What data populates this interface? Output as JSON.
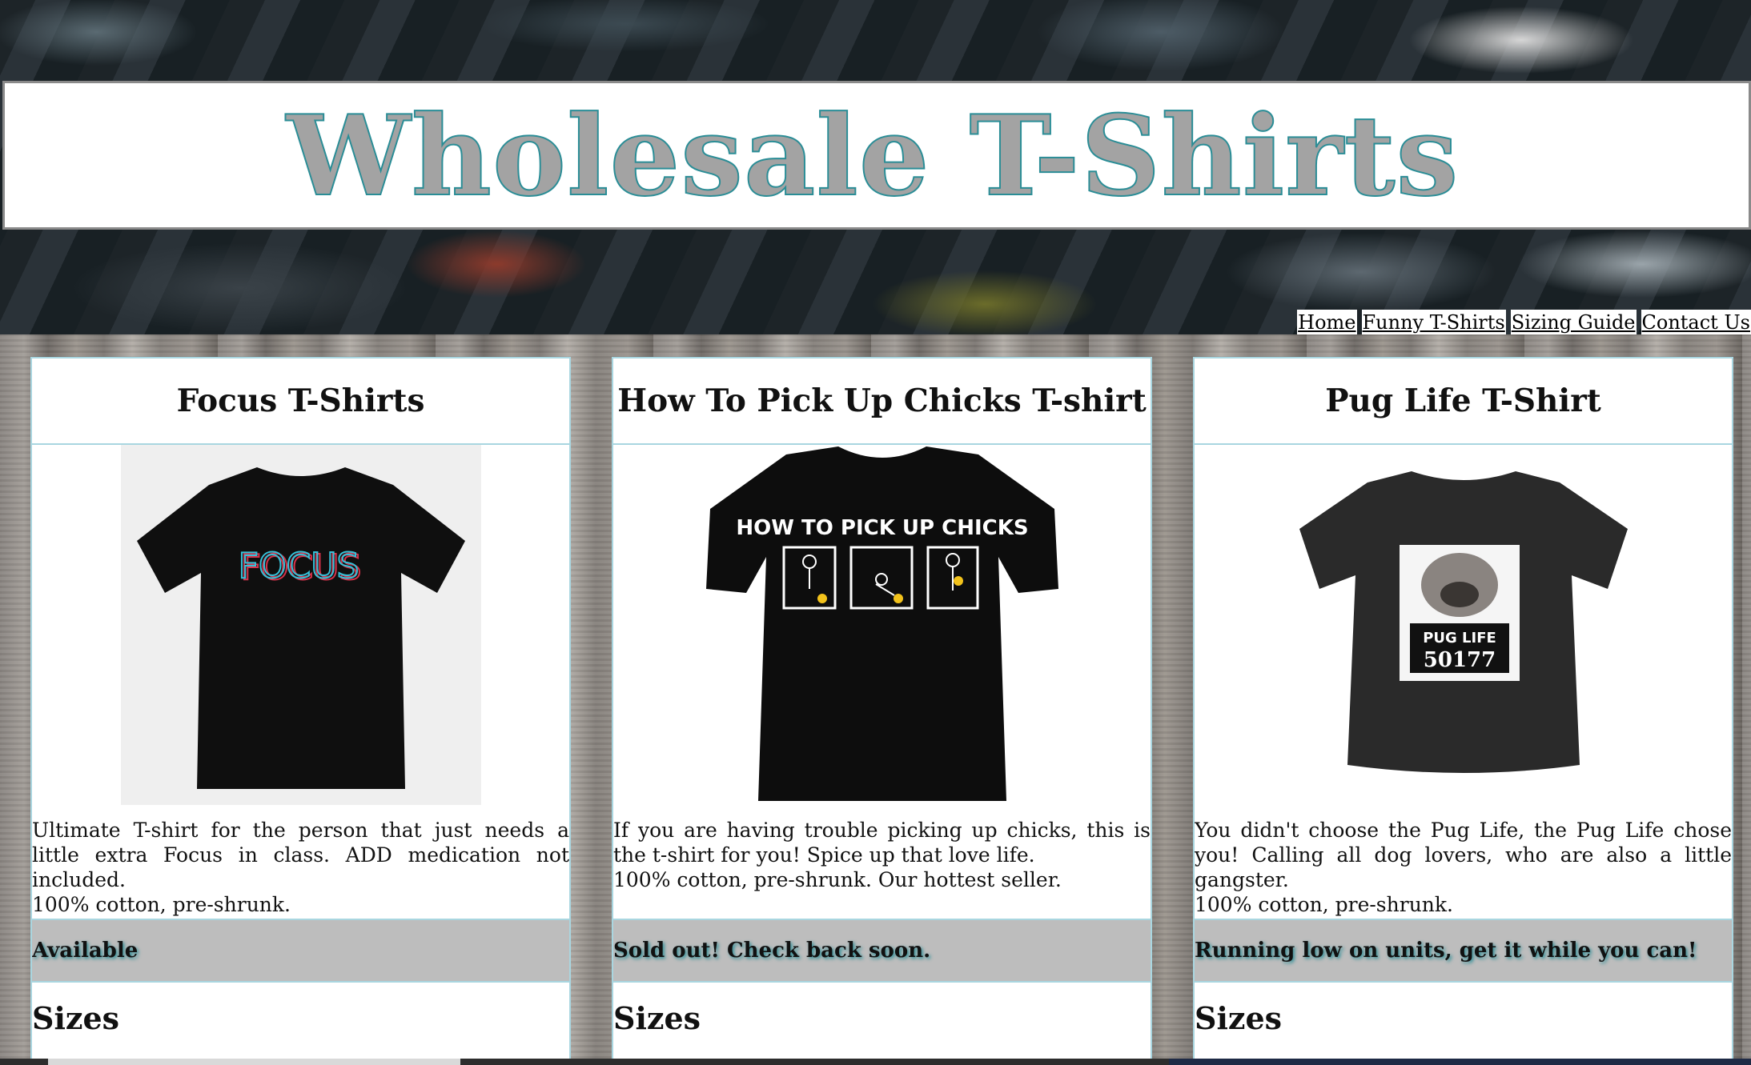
{
  "header": {
    "site_title": "Wholesale T-Shirts",
    "nav": [
      {
        "label": "Home"
      },
      {
        "label": "Funny T-Shirts"
      },
      {
        "label": "Sizing Guide"
      },
      {
        "label": "Contact Us"
      }
    ]
  },
  "products": [
    {
      "title": "Focus T-Shirts",
      "shirt_print": "FOCUS",
      "description": "Ultimate T-shirt for the person that just needs a little extra Focus in class. ADD medication not included.",
      "material": "100% cotton, pre-shrunk.",
      "status": "Available",
      "sizes_label": "Sizes"
    },
    {
      "title": "How To Pick Up Chicks T-shirt",
      "shirt_print": "HOW TO PICK UP CHICKS",
      "description": "If you are having trouble picking up chicks, this is the t-shirt for you! Spice up that love life.",
      "material": "100% cotton, pre-shrunk. Our hottest seller.",
      "status": "Sold out! Check back soon.",
      "sizes_label": "Sizes"
    },
    {
      "title": "Pug Life T-Shirt",
      "shirt_print": "PUG LIFE",
      "shirt_number": "50177",
      "description": "You didn't choose the Pug Life, the Pug Life chose you! Calling all dog lovers, who are also a little gangster.",
      "material": "100% cotton, pre-shrunk.",
      "status": "Running low on units, get it while you can!",
      "sizes_label": "Sizes"
    }
  ],
  "colors": {
    "title_fill": "#a3a3a3",
    "title_stroke": "#2a8d96",
    "card_border": "#a9d6e0",
    "status_bg": "#bdbdbd"
  }
}
